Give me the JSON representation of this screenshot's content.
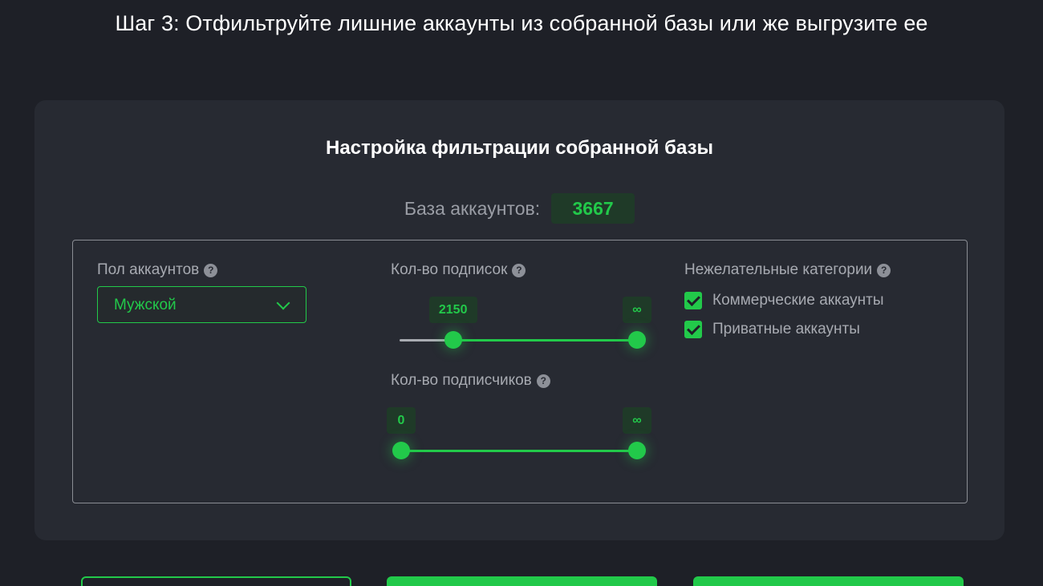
{
  "header": {
    "title": "Шаг 3: Отфильтруйте лишние аккаунты из собранной базы или же выгрузите ее"
  },
  "card": {
    "title": "Настройка фильтрации собранной базы",
    "base_label": "База аккаунтов:",
    "base_value": "3667"
  },
  "gender": {
    "label": "Пол аккаунтов",
    "help_icon": "?",
    "selected": "Мужской"
  },
  "subscriptions": {
    "label": "Кол-во подписок",
    "help_icon": "?",
    "min_value": "2150",
    "max_value": "∞",
    "min_fraction": 0.22,
    "max_fraction": 1.0
  },
  "followers": {
    "label": "Кол-во подписчиков",
    "help_icon": "?",
    "min_value": "0",
    "max_value": "∞",
    "min_fraction": 0.0,
    "max_fraction": 1.0
  },
  "categories": {
    "label": "Нежелательные категории",
    "help_icon": "?",
    "items": [
      {
        "label": "Коммерческие аккаунты",
        "checked": true
      },
      {
        "label": "Приватные аккаунты",
        "checked": true
      }
    ]
  },
  "colors": {
    "accent": "#22c94a",
    "background": "#1e2027",
    "card": "#272a32"
  },
  "icons": {
    "help": "question-circle-icon",
    "dropdown": "chevron-down-icon",
    "check": "checkmark-icon"
  }
}
